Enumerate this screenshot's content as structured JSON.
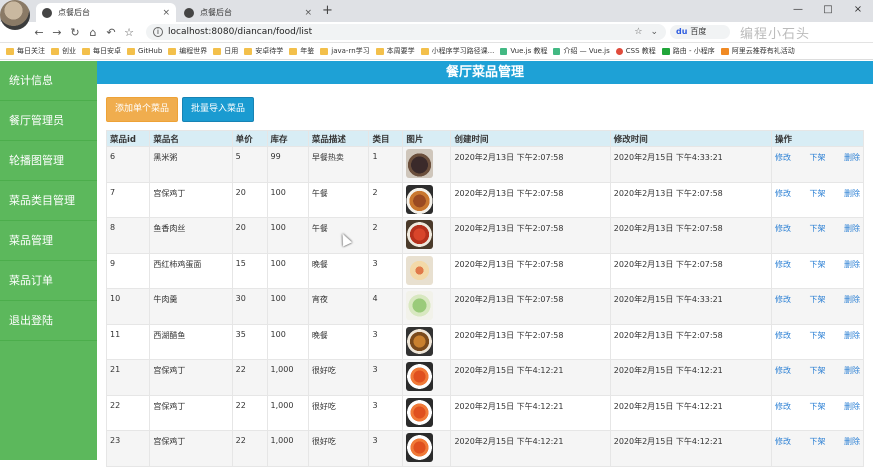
{
  "browser": {
    "tabs": [
      {
        "label": "点餐后台",
        "close": "×"
      },
      {
        "label": "点餐后台",
        "close": "×"
      }
    ],
    "new_tab": "+",
    "window_controls": [
      "—",
      "□",
      "×"
    ],
    "url": "localhost:8080/diancan/food/list",
    "search_engine": "百度",
    "watermark": "编程小石头",
    "bookmarks": [
      "每日关注",
      "创业",
      "每日安卓",
      "GitHub",
      "编程世界",
      "日用",
      "安卓待学",
      "年鉴",
      "java-rn学习",
      "本周要学",
      "小程序学习路径课...",
      "Vue.js 教程",
      "介绍 — Vue.js",
      "CSS 教程",
      "路由 - 小程序",
      "阿里云推荐有礼活动"
    ]
  },
  "sidebar": {
    "items": [
      {
        "label": "统计信息"
      },
      {
        "label": "餐厅管理员"
      },
      {
        "label": "轮播图管理"
      },
      {
        "label": "菜品类目管理"
      },
      {
        "label": "菜品管理"
      },
      {
        "label": "菜品订单"
      },
      {
        "label": "退出登陆"
      }
    ]
  },
  "page": {
    "title": "餐厅菜品管理",
    "add_single": "添加单个菜品",
    "batch_import": "批量导入菜品"
  },
  "table": {
    "headers": [
      "菜品id",
      "菜品名",
      "单价",
      "库存",
      "菜品描述",
      "类目",
      "图片",
      "创建时间",
      "修改时间",
      "操作"
    ],
    "ops": {
      "edit": "修改",
      "off": "下架",
      "delete": "删除"
    },
    "rows": [
      {
        "id": "6",
        "name": "黑米粥",
        "price": "5",
        "stock": "99",
        "desc": "早餐热卖",
        "category": "1",
        "img": "dark",
        "created": "2020年2月13日 下午2:07:58",
        "modified": "2020年2月15日 下午4:33:21"
      },
      {
        "id": "7",
        "name": "宫保鸡丁",
        "price": "20",
        "stock": "100",
        "desc": "午餐",
        "category": "2",
        "img": "dish-brown",
        "created": "2020年2月13日 下午2:07:58",
        "modified": "2020年2月13日 下午2:07:58"
      },
      {
        "id": "8",
        "name": "鱼香肉丝",
        "price": "20",
        "stock": "100",
        "desc": "午餐",
        "category": "2",
        "img": "dish-red",
        "created": "2020年2月13日 下午2:07:58",
        "modified": "2020年2月13日 下午2:07:58"
      },
      {
        "id": "9",
        "name": "西红柿鸡蛋面",
        "price": "15",
        "stock": "100",
        "desc": "晚餐",
        "category": "3",
        "img": "noodle",
        "created": "2020年2月13日 下午2:07:58",
        "modified": "2020年2月13日 下午2:07:58"
      },
      {
        "id": "10",
        "name": "牛肉羹",
        "price": "30",
        "stock": "100",
        "desc": "宵夜",
        "category": "4",
        "img": "soup",
        "created": "2020年2月13日 下午2:07:58",
        "modified": "2020年2月15日 下午4:33:21"
      },
      {
        "id": "11",
        "name": "西湖醋鱼",
        "price": "35",
        "stock": "100",
        "desc": "晚餐",
        "category": "3",
        "img": "fish",
        "created": "2020年2月13日 下午2:07:58",
        "modified": "2020年2月13日 下午2:07:58"
      },
      {
        "id": "21",
        "name": "宫保鸡丁",
        "price": "22",
        "stock": "1,000",
        "desc": "很好吃",
        "category": "3",
        "img": "shrimp",
        "created": "2020年2月15日 下午4:12:21",
        "modified": "2020年2月15日 下午4:12:21"
      },
      {
        "id": "22",
        "name": "宫保鸡丁",
        "price": "22",
        "stock": "1,000",
        "desc": "很好吃",
        "category": "3",
        "img": "shrimp",
        "created": "2020年2月15日 下午4:12:21",
        "modified": "2020年2月15日 下午4:12:21"
      },
      {
        "id": "23",
        "name": "宫保鸡丁",
        "price": "22",
        "stock": "1,000",
        "desc": "很好吃",
        "category": "3",
        "img": "shrimp",
        "created": "2020年2月15日 下午4:12:21",
        "modified": "2020年2月15日 下午4:12:21"
      }
    ]
  },
  "colors": {
    "sidebar": "#5cb85c",
    "title_bar": "#1ea1d6",
    "btn_orange": "#f0ad4e",
    "btn_blue": "#1a9bd1",
    "header_row": "#d8edf5",
    "link": "#2a7fd4"
  }
}
